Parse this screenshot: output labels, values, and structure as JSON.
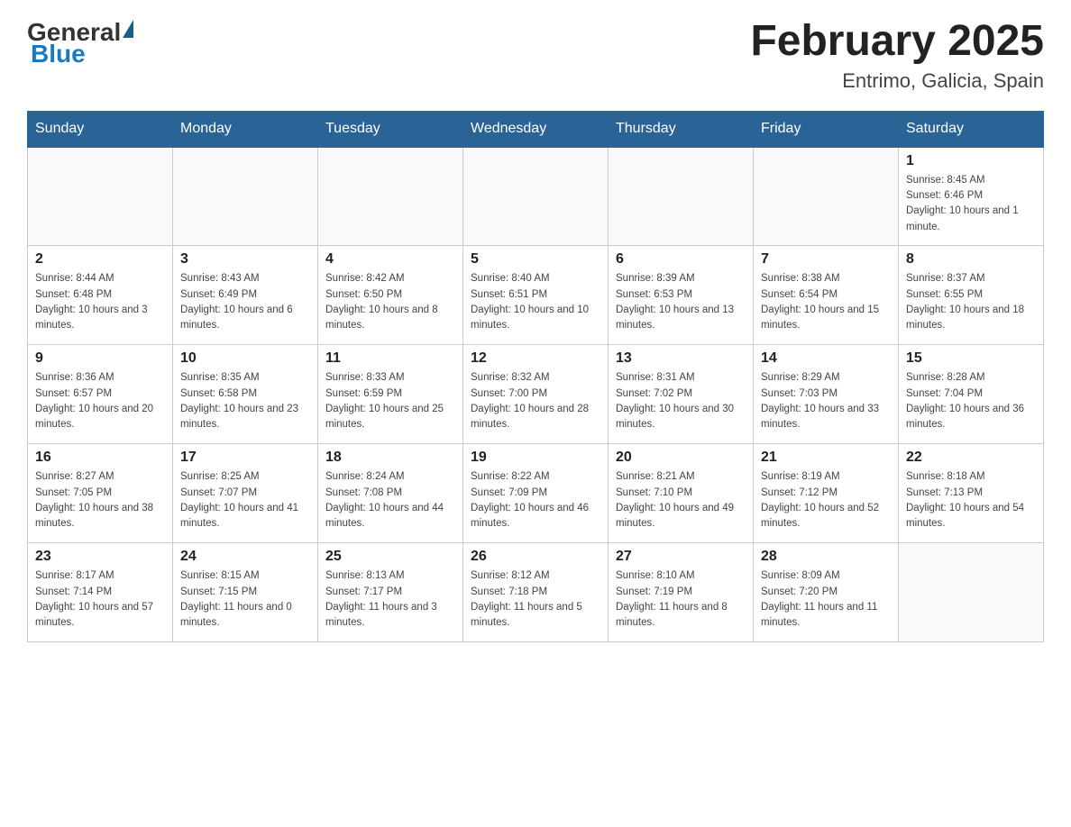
{
  "logo": {
    "general": "General",
    "blue": "Blue"
  },
  "header": {
    "month": "February 2025",
    "location": "Entrimo, Galicia, Spain"
  },
  "weekdays": [
    "Sunday",
    "Monday",
    "Tuesday",
    "Wednesday",
    "Thursday",
    "Friday",
    "Saturday"
  ],
  "weeks": [
    [
      {
        "day": "",
        "info": ""
      },
      {
        "day": "",
        "info": ""
      },
      {
        "day": "",
        "info": ""
      },
      {
        "day": "",
        "info": ""
      },
      {
        "day": "",
        "info": ""
      },
      {
        "day": "",
        "info": ""
      },
      {
        "day": "1",
        "info": "Sunrise: 8:45 AM\nSunset: 6:46 PM\nDaylight: 10 hours and 1 minute."
      }
    ],
    [
      {
        "day": "2",
        "info": "Sunrise: 8:44 AM\nSunset: 6:48 PM\nDaylight: 10 hours and 3 minutes."
      },
      {
        "day": "3",
        "info": "Sunrise: 8:43 AM\nSunset: 6:49 PM\nDaylight: 10 hours and 6 minutes."
      },
      {
        "day": "4",
        "info": "Sunrise: 8:42 AM\nSunset: 6:50 PM\nDaylight: 10 hours and 8 minutes."
      },
      {
        "day": "5",
        "info": "Sunrise: 8:40 AM\nSunset: 6:51 PM\nDaylight: 10 hours and 10 minutes."
      },
      {
        "day": "6",
        "info": "Sunrise: 8:39 AM\nSunset: 6:53 PM\nDaylight: 10 hours and 13 minutes."
      },
      {
        "day": "7",
        "info": "Sunrise: 8:38 AM\nSunset: 6:54 PM\nDaylight: 10 hours and 15 minutes."
      },
      {
        "day": "8",
        "info": "Sunrise: 8:37 AM\nSunset: 6:55 PM\nDaylight: 10 hours and 18 minutes."
      }
    ],
    [
      {
        "day": "9",
        "info": "Sunrise: 8:36 AM\nSunset: 6:57 PM\nDaylight: 10 hours and 20 minutes."
      },
      {
        "day": "10",
        "info": "Sunrise: 8:35 AM\nSunset: 6:58 PM\nDaylight: 10 hours and 23 minutes."
      },
      {
        "day": "11",
        "info": "Sunrise: 8:33 AM\nSunset: 6:59 PM\nDaylight: 10 hours and 25 minutes."
      },
      {
        "day": "12",
        "info": "Sunrise: 8:32 AM\nSunset: 7:00 PM\nDaylight: 10 hours and 28 minutes."
      },
      {
        "day": "13",
        "info": "Sunrise: 8:31 AM\nSunset: 7:02 PM\nDaylight: 10 hours and 30 minutes."
      },
      {
        "day": "14",
        "info": "Sunrise: 8:29 AM\nSunset: 7:03 PM\nDaylight: 10 hours and 33 minutes."
      },
      {
        "day": "15",
        "info": "Sunrise: 8:28 AM\nSunset: 7:04 PM\nDaylight: 10 hours and 36 minutes."
      }
    ],
    [
      {
        "day": "16",
        "info": "Sunrise: 8:27 AM\nSunset: 7:05 PM\nDaylight: 10 hours and 38 minutes."
      },
      {
        "day": "17",
        "info": "Sunrise: 8:25 AM\nSunset: 7:07 PM\nDaylight: 10 hours and 41 minutes."
      },
      {
        "day": "18",
        "info": "Sunrise: 8:24 AM\nSunset: 7:08 PM\nDaylight: 10 hours and 44 minutes."
      },
      {
        "day": "19",
        "info": "Sunrise: 8:22 AM\nSunset: 7:09 PM\nDaylight: 10 hours and 46 minutes."
      },
      {
        "day": "20",
        "info": "Sunrise: 8:21 AM\nSunset: 7:10 PM\nDaylight: 10 hours and 49 minutes."
      },
      {
        "day": "21",
        "info": "Sunrise: 8:19 AM\nSunset: 7:12 PM\nDaylight: 10 hours and 52 minutes."
      },
      {
        "day": "22",
        "info": "Sunrise: 8:18 AM\nSunset: 7:13 PM\nDaylight: 10 hours and 54 minutes."
      }
    ],
    [
      {
        "day": "23",
        "info": "Sunrise: 8:17 AM\nSunset: 7:14 PM\nDaylight: 10 hours and 57 minutes."
      },
      {
        "day": "24",
        "info": "Sunrise: 8:15 AM\nSunset: 7:15 PM\nDaylight: 11 hours and 0 minutes."
      },
      {
        "day": "25",
        "info": "Sunrise: 8:13 AM\nSunset: 7:17 PM\nDaylight: 11 hours and 3 minutes."
      },
      {
        "day": "26",
        "info": "Sunrise: 8:12 AM\nSunset: 7:18 PM\nDaylight: 11 hours and 5 minutes."
      },
      {
        "day": "27",
        "info": "Sunrise: 8:10 AM\nSunset: 7:19 PM\nDaylight: 11 hours and 8 minutes."
      },
      {
        "day": "28",
        "info": "Sunrise: 8:09 AM\nSunset: 7:20 PM\nDaylight: 11 hours and 11 minutes."
      },
      {
        "day": "",
        "info": ""
      }
    ]
  ]
}
